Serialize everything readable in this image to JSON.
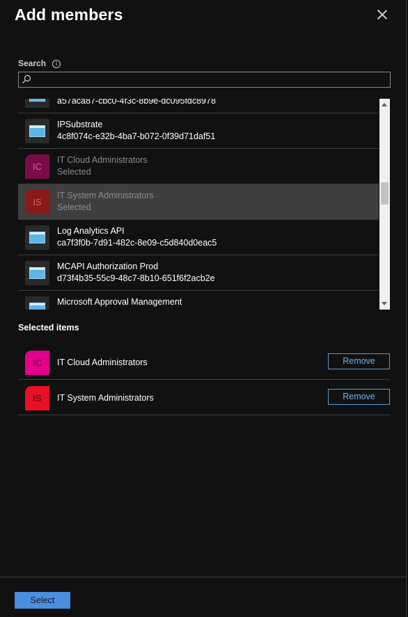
{
  "panel": {
    "title": "Add members"
  },
  "search": {
    "label": "Search",
    "info_glyph": "i",
    "value": "",
    "placeholder": ""
  },
  "results": [
    {
      "type": "app",
      "icon": "app-window-icon",
      "name": "",
      "sub": "a57aca87-cbc0-4f3c-8b9e-dc095fdc8978",
      "state": "normal"
    },
    {
      "type": "app",
      "icon": "app-window-icon",
      "name": "IPSubstrate",
      "sub": "4c8f074c-e32b-4ba7-b072-0f39d71daf51",
      "state": "normal"
    },
    {
      "type": "group",
      "initials": "IC",
      "color": "#7a0b4a",
      "text_color": "#d06aa0",
      "name": "IT Cloud Administrators",
      "sub": "Selected",
      "state": "dim"
    },
    {
      "type": "group",
      "initials": "IS",
      "color": "#8a1a1a",
      "text_color": "#e06060",
      "name": "IT System Administrators",
      "sub": "Selected",
      "state": "highlighted"
    },
    {
      "type": "app",
      "icon": "app-window-icon",
      "name": "Log Analytics API",
      "sub": "ca7f3f0b-7d91-482c-8e09-c5d840d0eac5",
      "state": "normal"
    },
    {
      "type": "app",
      "icon": "app-window-icon",
      "name": "MCAPI Authorization Prod",
      "sub": "d73f4b35-55c9-48c7-8b10-651f6f2acb2e",
      "state": "normal"
    },
    {
      "type": "app",
      "icon": "app-window-icon",
      "name": "Microsoft Approval Management",
      "sub": "",
      "state": "normal"
    }
  ],
  "selected": {
    "heading": "Selected items",
    "items": [
      {
        "initials": "IC",
        "color": "#e3008c",
        "text_color": "#5a0036",
        "name": "IT Cloud Administrators",
        "remove_label": "Remove"
      },
      {
        "initials": "IS",
        "color": "#e81123",
        "text_color": "#5a0008",
        "name": "IT System Administrators",
        "remove_label": "Remove"
      }
    ]
  },
  "footer": {
    "select_label": "Select"
  },
  "colors": {
    "background": "#111111",
    "accent": "#4a8fe0",
    "highlight_row": "#3f3f3f"
  }
}
